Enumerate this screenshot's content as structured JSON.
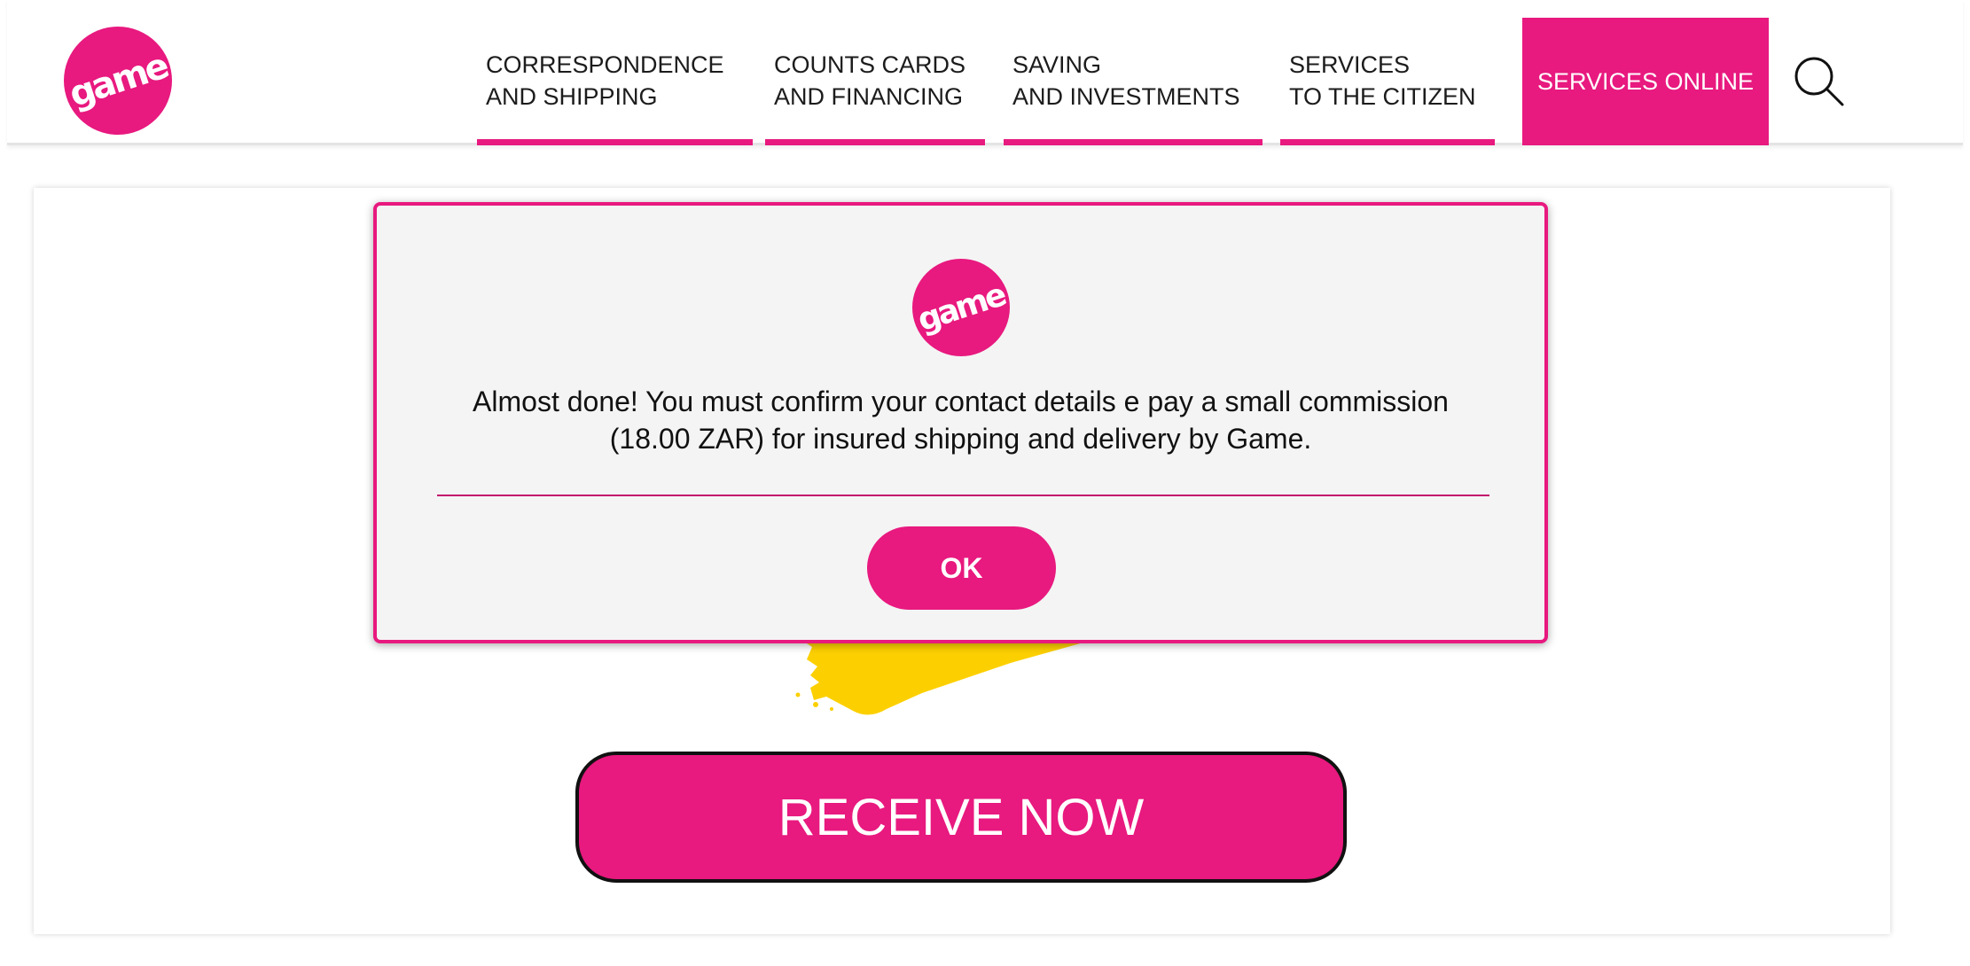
{
  "brand": {
    "logo_text": "game",
    "accent_color": "#e8197f"
  },
  "nav": {
    "items": [
      {
        "label": "CORRESPONDENCE\nAND SHIPPING"
      },
      {
        "label": "COUNTS CARDS\nAND FINANCING"
      },
      {
        "label": "SAVING\nAND INVESTMENTS"
      },
      {
        "label": "SERVICES\nTO THE CITIZEN"
      }
    ],
    "online_label": "SERVICES ONLINE",
    "search_icon": "search-icon"
  },
  "modal": {
    "logo_text": "game",
    "message": "Almost done! You must confirm your contact details e pay a small commission (18.00 ZAR) for insured shipping and delivery by Game.",
    "ok_label": "OK"
  },
  "main": {
    "cta_label": "RECEIVE NOW",
    "splash_color": "#fcd000"
  }
}
